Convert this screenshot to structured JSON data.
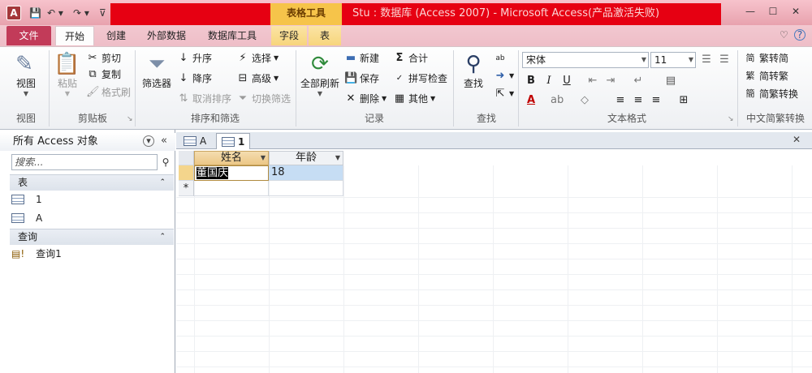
{
  "titlebar": {
    "app_letter": "A",
    "qat": {
      "save": "💾",
      "undo": "↶ ▾",
      "redo": "↷ ▾",
      "customize": "⊽"
    },
    "context_group": "表格工具",
    "window_title": "Stu : 数据库 (Access 2007) - Microsoft Access(产品激活失败)",
    "controls": {
      "minimize": "—",
      "maximize": "☐",
      "close": "✕"
    }
  },
  "tabs": {
    "file": "文件",
    "items": [
      "开始",
      "创建",
      "外部数据",
      "数据库工具",
      "字段",
      "表"
    ],
    "help_icons": {
      "collapse": "♡",
      "help": "?"
    }
  },
  "ribbon": {
    "view_group": {
      "label": "视图",
      "button": "视图"
    },
    "clipboard_group": {
      "label": "剪贴板",
      "paste": "粘贴",
      "cut": "剪切",
      "copy": "复制",
      "format_painter": "格式刷"
    },
    "sort_group": {
      "label": "排序和筛选",
      "filter": "筛选器",
      "ascending": "升序",
      "descending": "降序",
      "remove_sort": "取消排序",
      "selection": "选择",
      "advanced": "高级",
      "toggle_filter": "切换筛选"
    },
    "records_group": {
      "label": "记录",
      "refresh": "全部刷新",
      "new": "新建",
      "save": "保存",
      "delete": "删除",
      "totals": "合计",
      "spelling": "拼写检查",
      "more": "其他"
    },
    "find_group": {
      "label": "查找",
      "find": "查找"
    },
    "text_group": {
      "label": "文本格式",
      "font": "宋体",
      "size": "11"
    },
    "chinese_group": {
      "label": "中文简繁转换",
      "to_simplified": "繁转简",
      "to_traditional": "简转繁",
      "convert": "简繁转换"
    }
  },
  "nav": {
    "header": "所有 Access 对象",
    "search_placeholder": "搜索...",
    "groups": [
      {
        "label": "表",
        "items": [
          "1",
          "A"
        ]
      },
      {
        "label": "查询",
        "items": [
          "查询1"
        ]
      }
    ]
  },
  "doc_tabs": [
    "A",
    "1"
  ],
  "datasheet": {
    "columns": [
      "姓名",
      "年龄"
    ],
    "rows": [
      [
        "董国庆",
        "18"
      ]
    ],
    "new_row_marker": "*"
  }
}
